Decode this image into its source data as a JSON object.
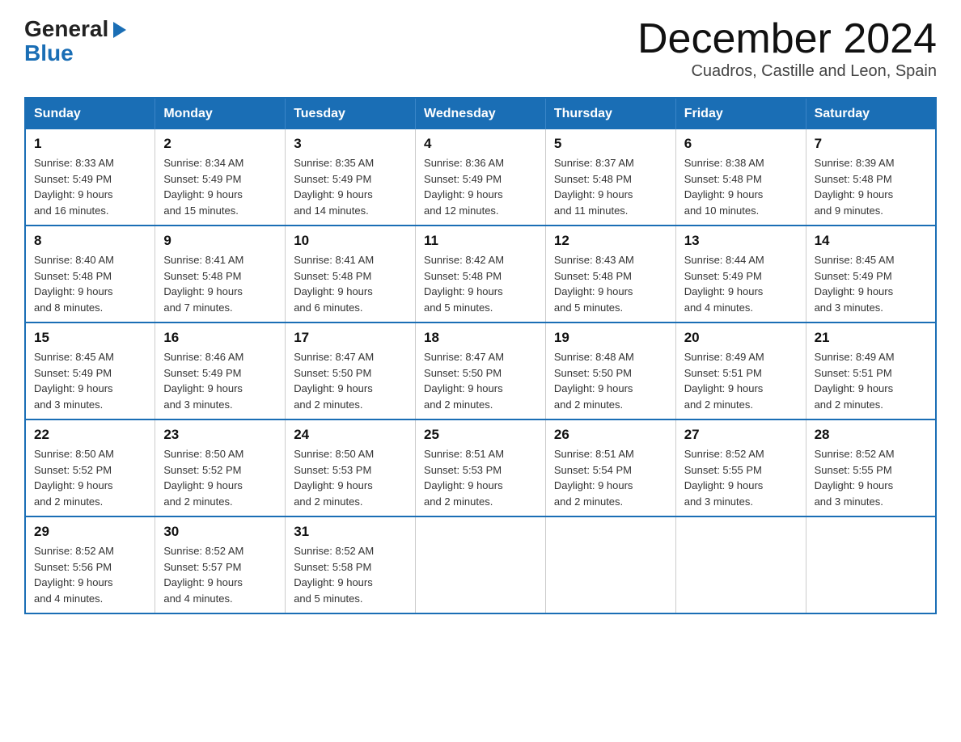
{
  "header": {
    "logo_general": "General",
    "logo_blue": "Blue",
    "month_title": "December 2024",
    "subtitle": "Cuadros, Castille and Leon, Spain"
  },
  "days_of_week": [
    "Sunday",
    "Monday",
    "Tuesday",
    "Wednesday",
    "Thursday",
    "Friday",
    "Saturday"
  ],
  "weeks": [
    [
      {
        "day": "1",
        "sunrise": "8:33 AM",
        "sunset": "5:49 PM",
        "daylight": "9 hours and 16 minutes."
      },
      {
        "day": "2",
        "sunrise": "8:34 AM",
        "sunset": "5:49 PM",
        "daylight": "9 hours and 15 minutes."
      },
      {
        "day": "3",
        "sunrise": "8:35 AM",
        "sunset": "5:49 PM",
        "daylight": "9 hours and 14 minutes."
      },
      {
        "day": "4",
        "sunrise": "8:36 AM",
        "sunset": "5:49 PM",
        "daylight": "9 hours and 12 minutes."
      },
      {
        "day": "5",
        "sunrise": "8:37 AM",
        "sunset": "5:48 PM",
        "daylight": "9 hours and 11 minutes."
      },
      {
        "day": "6",
        "sunrise": "8:38 AM",
        "sunset": "5:48 PM",
        "daylight": "9 hours and 10 minutes."
      },
      {
        "day": "7",
        "sunrise": "8:39 AM",
        "sunset": "5:48 PM",
        "daylight": "9 hours and 9 minutes."
      }
    ],
    [
      {
        "day": "8",
        "sunrise": "8:40 AM",
        "sunset": "5:48 PM",
        "daylight": "9 hours and 8 minutes."
      },
      {
        "day": "9",
        "sunrise": "8:41 AM",
        "sunset": "5:48 PM",
        "daylight": "9 hours and 7 minutes."
      },
      {
        "day": "10",
        "sunrise": "8:41 AM",
        "sunset": "5:48 PM",
        "daylight": "9 hours and 6 minutes."
      },
      {
        "day": "11",
        "sunrise": "8:42 AM",
        "sunset": "5:48 PM",
        "daylight": "9 hours and 5 minutes."
      },
      {
        "day": "12",
        "sunrise": "8:43 AM",
        "sunset": "5:48 PM",
        "daylight": "9 hours and 5 minutes."
      },
      {
        "day": "13",
        "sunrise": "8:44 AM",
        "sunset": "5:49 PM",
        "daylight": "9 hours and 4 minutes."
      },
      {
        "day": "14",
        "sunrise": "8:45 AM",
        "sunset": "5:49 PM",
        "daylight": "9 hours and 3 minutes."
      }
    ],
    [
      {
        "day": "15",
        "sunrise": "8:45 AM",
        "sunset": "5:49 PM",
        "daylight": "9 hours and 3 minutes."
      },
      {
        "day": "16",
        "sunrise": "8:46 AM",
        "sunset": "5:49 PM",
        "daylight": "9 hours and 3 minutes."
      },
      {
        "day": "17",
        "sunrise": "8:47 AM",
        "sunset": "5:50 PM",
        "daylight": "9 hours and 2 minutes."
      },
      {
        "day": "18",
        "sunrise": "8:47 AM",
        "sunset": "5:50 PM",
        "daylight": "9 hours and 2 minutes."
      },
      {
        "day": "19",
        "sunrise": "8:48 AM",
        "sunset": "5:50 PM",
        "daylight": "9 hours and 2 minutes."
      },
      {
        "day": "20",
        "sunrise": "8:49 AM",
        "sunset": "5:51 PM",
        "daylight": "9 hours and 2 minutes."
      },
      {
        "day": "21",
        "sunrise": "8:49 AM",
        "sunset": "5:51 PM",
        "daylight": "9 hours and 2 minutes."
      }
    ],
    [
      {
        "day": "22",
        "sunrise": "8:50 AM",
        "sunset": "5:52 PM",
        "daylight": "9 hours and 2 minutes."
      },
      {
        "day": "23",
        "sunrise": "8:50 AM",
        "sunset": "5:52 PM",
        "daylight": "9 hours and 2 minutes."
      },
      {
        "day": "24",
        "sunrise": "8:50 AM",
        "sunset": "5:53 PM",
        "daylight": "9 hours and 2 minutes."
      },
      {
        "day": "25",
        "sunrise": "8:51 AM",
        "sunset": "5:53 PM",
        "daylight": "9 hours and 2 minutes."
      },
      {
        "day": "26",
        "sunrise": "8:51 AM",
        "sunset": "5:54 PM",
        "daylight": "9 hours and 2 minutes."
      },
      {
        "day": "27",
        "sunrise": "8:52 AM",
        "sunset": "5:55 PM",
        "daylight": "9 hours and 3 minutes."
      },
      {
        "day": "28",
        "sunrise": "8:52 AM",
        "sunset": "5:55 PM",
        "daylight": "9 hours and 3 minutes."
      }
    ],
    [
      {
        "day": "29",
        "sunrise": "8:52 AM",
        "sunset": "5:56 PM",
        "daylight": "9 hours and 4 minutes."
      },
      {
        "day": "30",
        "sunrise": "8:52 AM",
        "sunset": "5:57 PM",
        "daylight": "9 hours and 4 minutes."
      },
      {
        "day": "31",
        "sunrise": "8:52 AM",
        "sunset": "5:58 PM",
        "daylight": "9 hours and 5 minutes."
      },
      null,
      null,
      null,
      null
    ]
  ]
}
